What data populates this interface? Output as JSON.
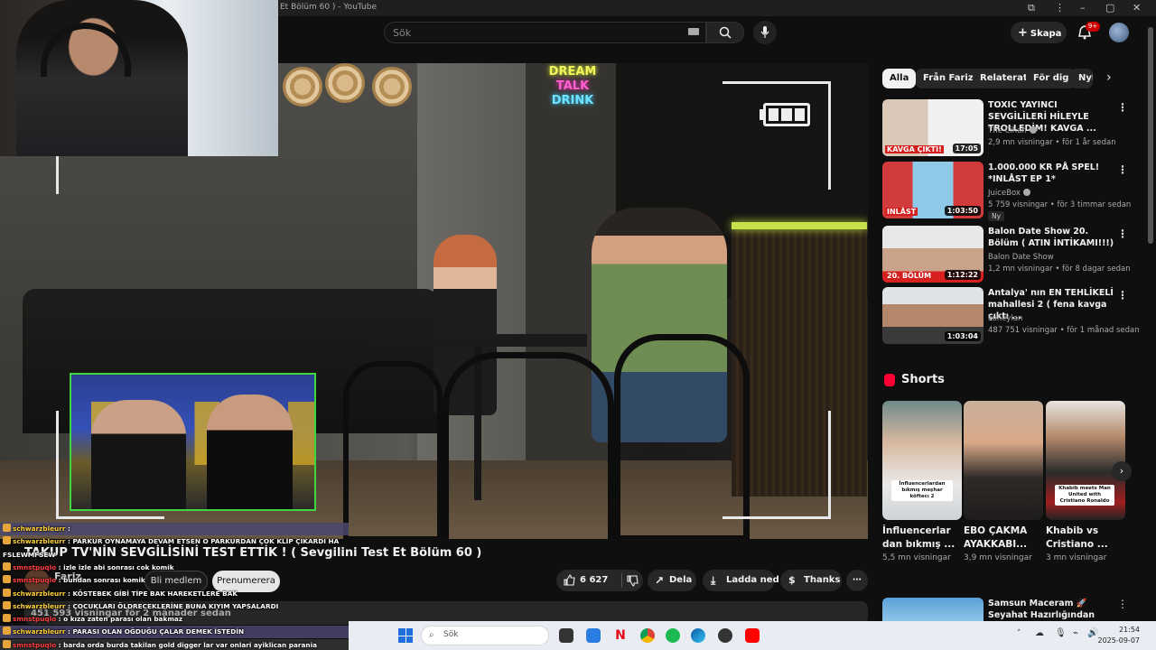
{
  "window": {
    "title": "Et Bölüm 60 ) - YouTube"
  },
  "header": {
    "search_placeholder": "Sök",
    "create_label": "Skapa",
    "notification_count": "9+"
  },
  "video": {
    "title": "TAKUP TV'NİN SEVGİLİSİNİ TEST ETTİK ! ( Sevgilini Test Et Bölüm 60 )",
    "channel_name": "Fariz",
    "join_label": "Bli medlem",
    "subscribe_label": "Prenumerera",
    "likes": "6 627",
    "share_label": "Dela",
    "download_label": "Ladda ned",
    "thanks_label": "Thanks",
    "views_line": "451 593 visningar  för 2 månader sedan",
    "neon_sign": [
      "DREAM",
      "TALK",
      "DRINK"
    ]
  },
  "chat": [
    {
      "user": "schwarzbleurr",
      "msg": "",
      "style": "hl"
    },
    {
      "user": "schwarzbleurr",
      "msg": "PARKUR OYNAMAYA DEVAM ETSEN O PARKURDAN ÇOK KLİP ÇIKARDI HA",
      "style": ""
    },
    {
      "user": "",
      "msg": "FSLEWMFSEW",
      "style": ""
    },
    {
      "user": "smnstpuqlo",
      "msg": "izle izle abi sonrası cok komik",
      "style": "",
      "red": true
    },
    {
      "user": "smnstpuqlo",
      "msg": "bundan sonrası komik",
      "style": "",
      "red": true
    },
    {
      "user": "schwarzbleurr",
      "msg": "KÖSTEBEK GİBİ TİPE BAK HAREKETLERE BAK",
      "style": ""
    },
    {
      "user": "schwarzbleurr",
      "msg": "ÇOCUKLARI ÖLDRECEKLERİNE BUNA KIYIM YAPSALARDI",
      "style": ""
    },
    {
      "user": "smnstpuqlo",
      "msg": "o kıza zaten parası olan bakmaz",
      "style": "",
      "red": true
    },
    {
      "user": "schwarzbleurr",
      "msg": "PARASI OLAN OĞDUĞU ÇALAR DEMEK İSTEDİN",
      "style": "hl"
    },
    {
      "user": "smnstpuqlo",
      "msg": "barda orda burda takilan gold digger lar var onlari ayiklican parania",
      "style": "hl2",
      "red": true
    }
  ],
  "sidebar": {
    "chips": [
      "Alla",
      "Från Fariz",
      "Relaterat",
      "För dig",
      "Nyli"
    ],
    "recommendations": [
      {
        "title": "TOXIC YAYINCI SEVGİLİLERİ HİLEYLE TROLLEDİM! KAVGA ...",
        "channel": "The Cihan",
        "verified": true,
        "meta": "2,9 mn visningar • för 1 år sedan",
        "duration": "17:05",
        "thumb_text": "KAVGA ÇIKTI!",
        "badge": ""
      },
      {
        "title": "1.000.000 KR PÅ SPEL! *INLÅST EP 1*",
        "channel": "JuiceBox",
        "verified": true,
        "meta": "5 759 visningar • för 3 timmar sedan",
        "duration": "1:03:50",
        "thumb_text": "INLÅST",
        "badge": "Ny"
      },
      {
        "title": "Balon Date Show 20. Bölüm ( ATIN İNTİKAMI!!!)",
        "channel": "Balon Date Show",
        "verified": false,
        "meta": "1,2 mn visningar • för 8 dagar sedan",
        "duration": "1:12:22",
        "thumb_text": "20. BÖLÜM",
        "badge": ""
      },
      {
        "title": "Antalya' nın EN TEHLİKELİ mahallesi 2 ( fena kavga çıktı ...",
        "channel": "koheylan",
        "verified": false,
        "meta": "487 751 visningar • för 1 månad sedan",
        "duration": "1:03:04",
        "thumb_text": "",
        "badge": ""
      }
    ],
    "shorts_heading": "Shorts",
    "shorts": [
      {
        "title": "İnfluencerlar dan bıkmış ...",
        "views": "5,5 mn visningar",
        "caption": "İnfluencerlardan bıkmış meşhar köftecı 2"
      },
      {
        "title": "EBO ÇAKMA AYAKKABI...",
        "views": "3,9 mn visningar",
        "caption": ""
      },
      {
        "title": "Khabib vs Cristiano ...",
        "views": "3 mn visningar",
        "caption": "Khabib meets Man United with Cristiano Ronaldo"
      }
    ],
    "next_rec": {
      "title": "Samsun Maceram 🚀 Seyahat Hazırlığından Eğlenceye! 🍀 ..."
    }
  },
  "taskbar": {
    "search_label": "Sök",
    "time": "21:54",
    "date": "2025-09-07"
  },
  "colors": {
    "accent_red": "#ff0033",
    "pip_border": "#3fd63f",
    "chat_user": "#ffd23a"
  }
}
